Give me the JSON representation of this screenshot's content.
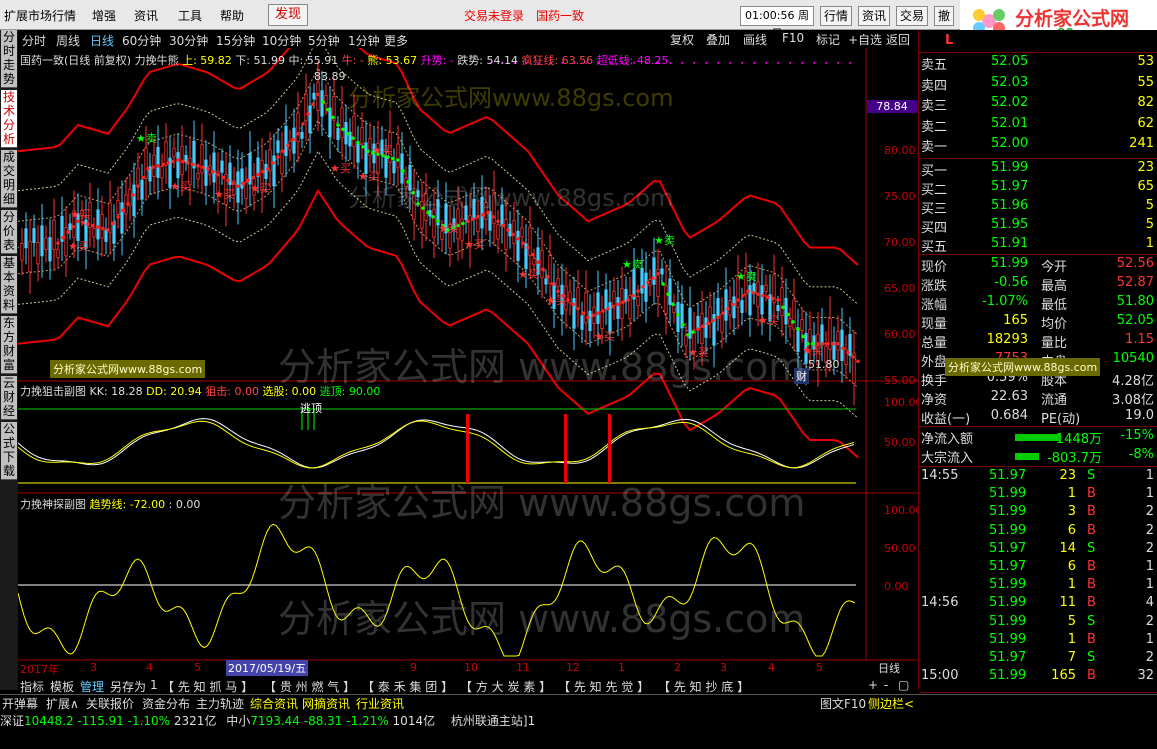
{
  "menu": {
    "items": [
      "扩展市场行情",
      "增强",
      "资讯",
      "工具",
      "帮助"
    ],
    "find": "发现",
    "notice1": "交易未登录",
    "notice2": "国药一致",
    "time": "01:00:56",
    "weekday": "周日",
    "top_buttons": [
      "行情",
      "资讯",
      "交易",
      "撤"
    ],
    "logo_title": "分析家公式网",
    "logo_url": "www.88gs.com"
  },
  "sidebar": {
    "tabs": [
      "分时走势",
      "技术分析",
      "成交明细",
      "分价表",
      "基本资料",
      "东方财富",
      "云财经",
      "公式下载"
    ]
  },
  "periods": [
    "分时",
    "周线",
    "日线",
    "60分钟",
    "30分钟",
    "15分钟",
    "10分钟",
    "5分钟",
    "1分钟",
    "更多"
  ],
  "period_selected": "日线",
  "chart_tools": [
    "复权",
    "叠加",
    "画线",
    "F10",
    "标记",
    "+自选",
    "返回"
  ],
  "main_title": {
    "name": "国药一致(日线 前复权)",
    "indicator": "力挽牛熊",
    "up": "上: 59.82",
    "down": "下: 51.99",
    "mid": "中: 55.91",
    "niu": "牛: -",
    "xiong": "熊: 53.67",
    "shengshi": "升势: -",
    "dieshi": "跌势: 54.14",
    "fengkuang": "疯狂线: 63.56",
    "chaodi": "超低线: 48.25"
  },
  "price_axis": [
    "80.00",
    "75.00",
    "70.00",
    "65.00",
    "60.00",
    "55.00"
  ],
  "current_price_tag": "78.84",
  "high_label": "83.89",
  "low_label": "51.80",
  "cai_label": "财",
  "signal_buy": "买",
  "signal_sell": "卖",
  "sub1": {
    "title": "力挽狙击副图",
    "kk": "KK: 18.28",
    "dd": "DD: 20.94",
    "ju": "狙击: 0.00",
    "xuangu": "选股: 0.00",
    "taoding": "逃顶: 90.00",
    "tag": "逃顶",
    "axis": [
      "100.00",
      "50.00"
    ]
  },
  "sub2": {
    "title": "力挽神探副图",
    "trend": "趋势线: -72.00",
    "extra": ": 0.00",
    "axis": [
      "100.00",
      "50.00",
      "0.00"
    ]
  },
  "date_axis": {
    "items": [
      "2017年",
      "3",
      "4",
      "5",
      "9",
      "10",
      "11",
      "12",
      "1",
      "2",
      "3",
      "4",
      "5"
    ],
    "cursor_date": "2017/05/19/五",
    "period_label": "日线"
  },
  "bottom_tabs": {
    "left": [
      "指标",
      "模板",
      "管理",
      "另存为",
      "1"
    ],
    "formulas": [
      "【 先 知 抓 马 】",
      "【 贵 州 燃 气 】",
      "【 泰 禾 集 团 】",
      "【 方 大 炭 素 】",
      "【 先 知 先 觉 】",
      "【 先 知 抄 底 】"
    ]
  },
  "orderbook": {
    "symbol_mark": "L",
    "asks": [
      {
        "label": "卖五",
        "price": "52.05",
        "vol": "53"
      },
      {
        "label": "卖四",
        "price": "52.03",
        "vol": "55"
      },
      {
        "label": "卖三",
        "price": "52.02",
        "vol": "82"
      },
      {
        "label": "卖二",
        "price": "52.01",
        "vol": "62"
      },
      {
        "label": "卖一",
        "price": "52.00",
        "vol": "241"
      }
    ],
    "bids": [
      {
        "label": "买一",
        "price": "51.99",
        "vol": "23"
      },
      {
        "label": "买二",
        "price": "51.97",
        "vol": "65"
      },
      {
        "label": "买三",
        "price": "51.96",
        "vol": "5"
      },
      {
        "label": "买四",
        "price": "51.95",
        "vol": "5"
      },
      {
        "label": "买五",
        "price": "51.91",
        "vol": "1"
      }
    ]
  },
  "quote": [
    {
      "l1": "现价",
      "v1": "51.99",
      "l2": "今开",
      "v2": "52.56"
    },
    {
      "l1": "涨跌",
      "v1": "-0.56",
      "l2": "最高",
      "v2": "52.87"
    },
    {
      "l1": "涨幅",
      "v1": "-1.07%",
      "l2": "最低",
      "v2": "51.80"
    },
    {
      "l1": "现量",
      "v1": "165",
      "l2": "均价",
      "v2": "52.05"
    },
    {
      "l1": "总量",
      "v1": "18293",
      "l2": "量比",
      "v2": "1.15"
    },
    {
      "l1": "外盘",
      "v1": "7753",
      "l2": "内盘",
      "v2": "10540"
    },
    {
      "l1": "换手",
      "v1": "0.59%",
      "l2": "股本",
      "v2": "4.28亿"
    },
    {
      "l1": "净资",
      "v1": "22.63",
      "l2": "流通",
      "v2": "3.08亿"
    },
    {
      "l1": "收益(一)",
      "v1": "0.684",
      "l2": "PE(动)",
      "v2": "19.0"
    }
  ],
  "flows": [
    {
      "label": "净流入额",
      "value": "-1448万",
      "pct": "-15%"
    },
    {
      "label": "大宗流入",
      "value": "-803.7万",
      "pct": "-8%"
    }
  ],
  "ticks": [
    {
      "time": "14:55",
      "price": "51.97",
      "vol": "23",
      "side": "S",
      "n": "1"
    },
    {
      "time": "",
      "price": "51.99",
      "vol": "1",
      "side": "B",
      "n": "1"
    },
    {
      "time": "",
      "price": "51.99",
      "vol": "3",
      "side": "B",
      "n": "2"
    },
    {
      "time": "",
      "price": "51.99",
      "vol": "6",
      "side": "B",
      "n": "2"
    },
    {
      "time": "",
      "price": "51.97",
      "vol": "14",
      "side": "S",
      "n": "2"
    },
    {
      "time": "",
      "price": "51.97",
      "vol": "6",
      "side": "B",
      "n": "1"
    },
    {
      "time": "",
      "price": "51.99",
      "vol": "1",
      "side": "B",
      "n": "1"
    },
    {
      "time": "14:56",
      "price": "51.99",
      "vol": "11",
      "side": "B",
      "n": "4"
    },
    {
      "time": "",
      "price": "51.99",
      "vol": "5",
      "side": "S",
      "n": "2"
    },
    {
      "time": "",
      "price": "51.99",
      "vol": "1",
      "side": "B",
      "n": "1"
    },
    {
      "time": "",
      "price": "51.97",
      "vol": "7",
      "side": "S",
      "n": "2"
    },
    {
      "time": "15:00",
      "price": "51.99",
      "vol": "165",
      "side": "B",
      "n": "32"
    }
  ],
  "right_tabs": [
    "笔",
    "价",
    "细",
    "势",
    "联",
    "值",
    "主",
    "筹"
  ],
  "bottom_bar": {
    "items": [
      "开弹幕",
      "扩展∧",
      "关联报价",
      "资金分布",
      "主力轨迹",
      "综合资讯",
      "网摘资讯",
      "行业资讯"
    ],
    "right": [
      "图文F10",
      "侧边栏<"
    ]
  },
  "status": {
    "idx1_name": "深证",
    "idx1_val": "10448.2",
    "idx1_chg": "-115.91",
    "idx1_pct": "-1.10%",
    "idx1_amt": "2321亿",
    "idx2_name": "中小",
    "idx2_val": "7193.44",
    "idx2_chg": "-88.31",
    "idx2_pct": "-1.21%",
    "idx2_amt": "1014亿",
    "station": "杭州联通主站]1"
  },
  "watermark": [
    "分析家公式网www.88gs.com",
    "分析家公式网www.88gs.com",
    "分析家公式网 www.88gs.com",
    "分析家公式网 www.88gs.com",
    "分析家公式网 www.88gs.com"
  ],
  "watermark_small": [
    "分析家公式网www.88gs.com",
    "分析家公式网www.88gs.com"
  ]
}
